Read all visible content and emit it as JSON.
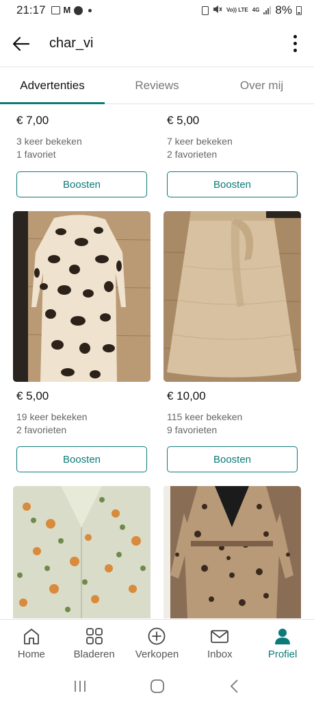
{
  "status_bar": {
    "time": "21:17",
    "battery": "8%",
    "network": "4G",
    "volte": "Vo)) LTE"
  },
  "header": {
    "title": "char_vi"
  },
  "tabs": [
    {
      "label": "Advertenties",
      "active": true
    },
    {
      "label": "Reviews",
      "active": false
    },
    {
      "label": "Over mij",
      "active": false
    }
  ],
  "listings": [
    {
      "price": "€ 7,00",
      "views": "3 keer bekeken",
      "favorites": "1 favoriet",
      "boost_label": "Boosten"
    },
    {
      "price": "€ 5,00",
      "views": "7 keer bekeken",
      "favorites": "2 favorieten",
      "boost_label": "Boosten"
    },
    {
      "price": "€ 5,00",
      "views": "19 keer bekeken",
      "favorites": "2 favorieten",
      "boost_label": "Boosten"
    },
    {
      "price": "€ 10,00",
      "views": "115 keer bekeken",
      "favorites": "9 favorieten",
      "boost_label": "Boosten"
    }
  ],
  "bottom_nav": [
    {
      "label": "Home",
      "icon": "home-icon",
      "active": false
    },
    {
      "label": "Bladeren",
      "icon": "grid-icon",
      "active": false
    },
    {
      "label": "Verkopen",
      "icon": "plus-circle-icon",
      "active": false
    },
    {
      "label": "Inbox",
      "icon": "envelope-icon",
      "active": false
    },
    {
      "label": "Profiel",
      "icon": "profile-icon",
      "active": true
    }
  ],
  "colors": {
    "accent": "#0b7a78",
    "text": "#111111",
    "muted": "#666666"
  }
}
